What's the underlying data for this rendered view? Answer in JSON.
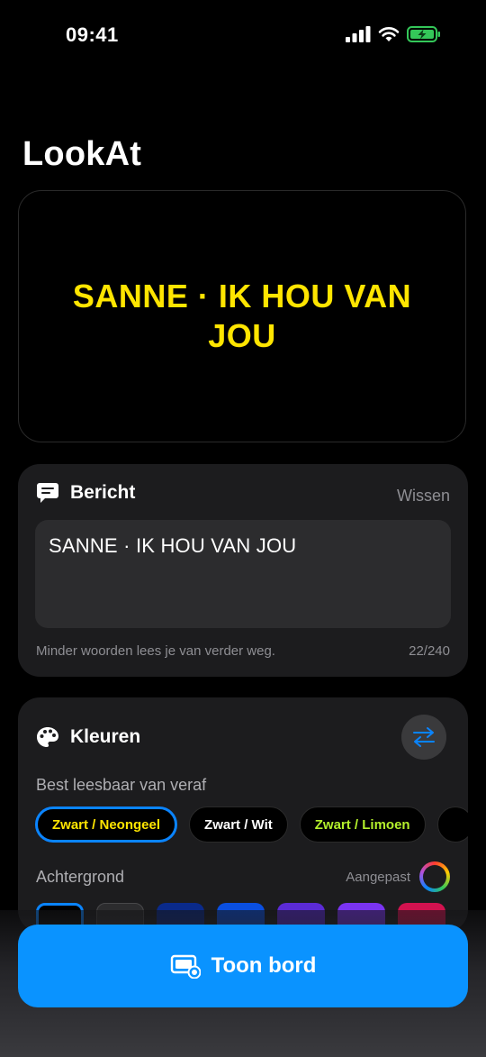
{
  "status_bar": {
    "time": "09:41"
  },
  "app": {
    "title": "LookAt"
  },
  "preview": {
    "text": "SANNE · IK HOU VAN JOU",
    "text_color": "#FFE500",
    "background_color": "#000000"
  },
  "message": {
    "title": "Bericht",
    "clear_label": "Wissen",
    "value": "SANNE · IK HOU VAN JOU",
    "hint": "Minder woorden lees je van verder weg.",
    "counter": "22/240"
  },
  "colors": {
    "title": "Kleuren",
    "presets_label": "Best leesbaar van veraf",
    "presets": [
      {
        "label": "Zwart / Neongeel",
        "text_color": "#FFE500",
        "active": true
      },
      {
        "label": "Zwart / Wit",
        "text_color": "#FFFFFF",
        "active": false
      },
      {
        "label": "Zwart / Limoen",
        "text_color": "#B4F02C",
        "active": false
      }
    ],
    "background_label": "Achtergrond",
    "custom_label": "Aangepast",
    "swatches": [
      "#000000",
      "#2c2c2e",
      "#0a2a8a",
      "#0a4fe0",
      "#5b2bd6",
      "#7a34f2",
      "#d2124f"
    ]
  },
  "cta": {
    "label": "Toon bord"
  }
}
